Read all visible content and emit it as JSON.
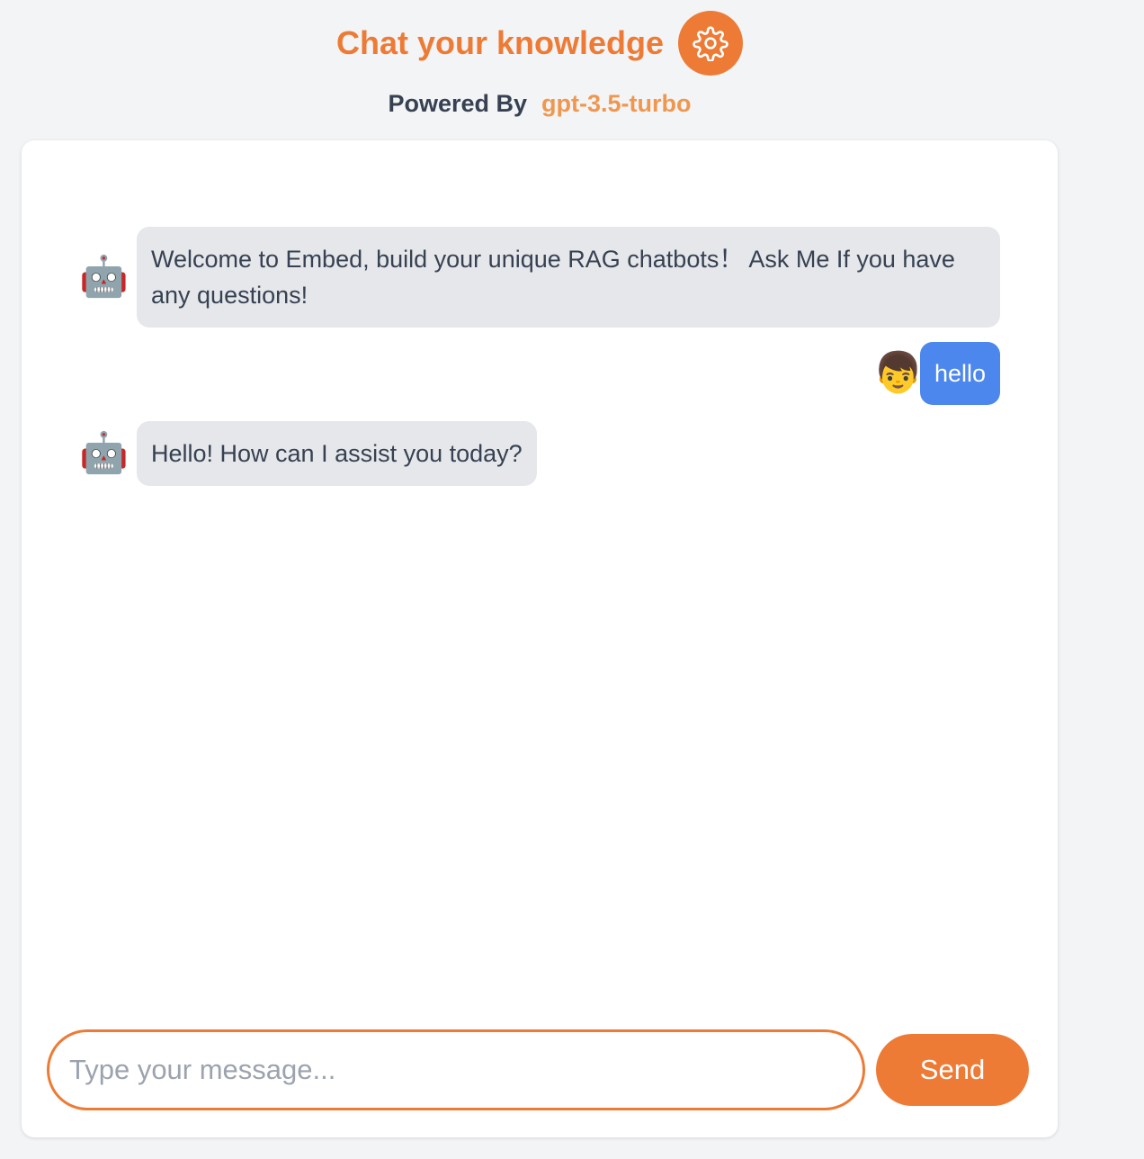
{
  "header": {
    "title": "Chat your knowledge",
    "settings_icon": "gear-icon",
    "powered_by_label": "Powered By",
    "model_name": "gpt-3.5-turbo"
  },
  "messages": [
    {
      "role": "assistant",
      "avatar": "🤖",
      "text": "Welcome to Embed, build your unique RAG chatbots！ Ask Me If you have any questions!"
    },
    {
      "role": "user",
      "avatar": "👦",
      "text": "hello"
    },
    {
      "role": "assistant",
      "avatar": "🤖",
      "text": "Hello! How can I assist you today?"
    }
  ],
  "composer": {
    "value": "",
    "placeholder": "Type your message...",
    "send_label": "Send"
  },
  "colors": {
    "accent": "#ed7b36",
    "model_text": "#f0974f",
    "user_bubble": "#4b87ec",
    "bot_bubble": "#e5e7eb",
    "page_background": "#f3f4f6"
  }
}
